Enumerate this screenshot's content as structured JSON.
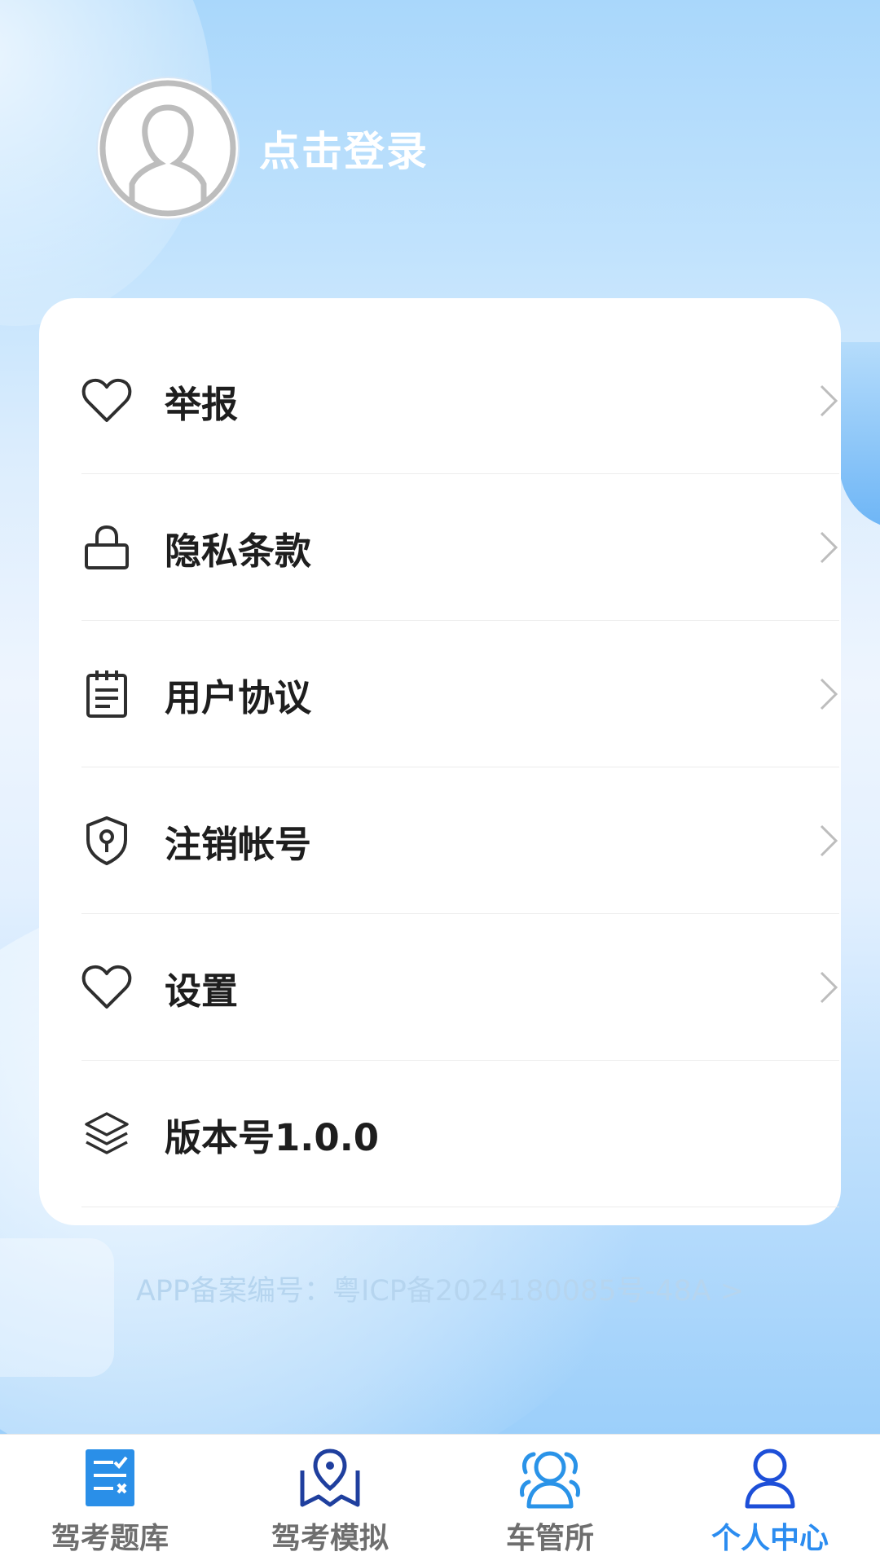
{
  "profile": {
    "login_label": "点击登录",
    "avatar_icon": "user-avatar-placeholder-icon"
  },
  "menu": {
    "items": [
      {
        "icon": "heart-icon",
        "label": "举报",
        "has_chevron": true
      },
      {
        "icon": "lock-icon",
        "label": "隐私条款",
        "has_chevron": true
      },
      {
        "icon": "notepad-icon",
        "label": "用户协议",
        "has_chevron": true
      },
      {
        "icon": "shield-key-icon",
        "label": "注销帐号",
        "has_chevron": true
      },
      {
        "icon": "heart-icon",
        "label": "设置",
        "has_chevron": true
      },
      {
        "icon": "layers-icon",
        "label": "版本号1.0.0",
        "has_chevron": false
      }
    ]
  },
  "footer": {
    "icp_text": "APP备案编号：粤ICP备2024180085号-48A >"
  },
  "tabbar": {
    "tabs": [
      {
        "label": "驾考题库",
        "icon": "question-bank-icon",
        "active": false
      },
      {
        "label": "驾考模拟",
        "icon": "map-pin-icon",
        "active": false
      },
      {
        "label": "车管所",
        "icon": "people-icon",
        "active": false
      },
      {
        "label": "个人中心",
        "icon": "person-icon",
        "active": true
      }
    ]
  },
  "colors": {
    "accent": "#2b8cf0",
    "tab_icon_dark": "#1f3f9e",
    "tab_icon_light": "#2a93e8"
  }
}
